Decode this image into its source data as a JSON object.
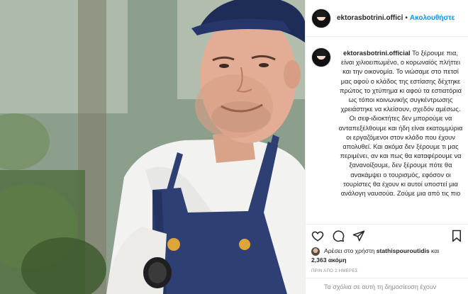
{
  "post": {
    "username": "ektorasbotrini.officⅰ",
    "header_separator": "•",
    "follow_label": "Ακολουθήστε",
    "caption_username": "ektorasbotrini.official",
    "caption_text": "Το ξέρουμε πια, είναι χιλιοειπωμένο, ο κορωναϊός πλήττει και την οικονομία. Το νιώσαμε στο πετσί μας αφού ο κλάδος της εστίασης δέχτηκε πρώτος το χτύπημα κι αφού τα εστιατόρια ως τόποι κοινωνικής συγκέντρωσης χρειάστηκε να κλείσουν, σχεδόν αμέσως. Οι σεφ-ιδιοκτήτες δεν μπορούμε να ανταπεξέλθουμε και ήδη είναι εκατομμύρια οι εργαζόμενοι στον κλάδο που έχουν απολυθεί. Και ακόμα δεν ξέρουμε τι μας περιμένει, αν και πως θα καταφέρουμε να ξανανοίξουμε, δεν ξέρουμε πότε θα ανακάμψει ο τουρισμός, εφόσον οι τουρίστες θα έχουν κι αυτοί υποστεί μια ανάλογη ναυσούα. Ζούμε μια από τις πιο",
    "likes_prefix": "Αρέσει στο χρήστη",
    "likes_user": "stathispouroutidis",
    "likes_and": "και",
    "likes_count": "2,363 ακόμη",
    "date": "ΠΡΙΝ ΑΠΟ 2 ΗΜΕΡΕΣ",
    "comments_closed": "Τα σχόλια σε αυτή τη δημοσίευση έχουν"
  },
  "icons": {
    "like": "heart-icon",
    "comment": "comment-icon",
    "share": "share-icon",
    "save": "bookmark-icon"
  },
  "colors": {
    "follow_blue": "#0095f6",
    "text": "#262626",
    "muted": "#8e8e8e",
    "border": "#efefef"
  }
}
